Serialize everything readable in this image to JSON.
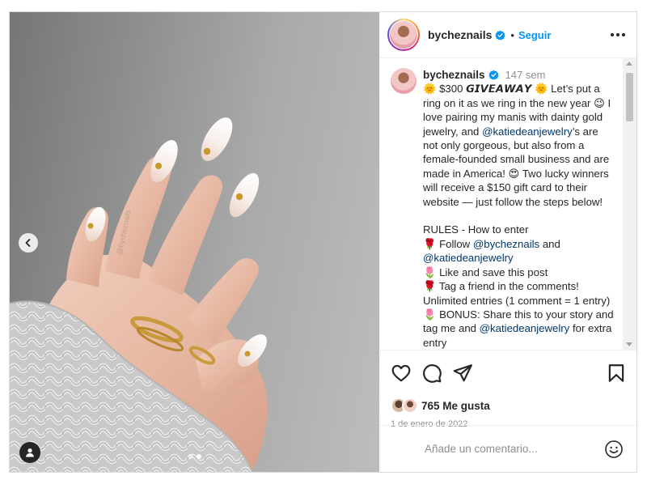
{
  "post": {
    "username": "bycheznails",
    "follow_label": "Seguir",
    "caption": {
      "username": "bycheznails",
      "time_ago": "147 sem",
      "segments": [
        {
          "t": "🌞 $300 "
        },
        {
          "t": "𝙂𝙄𝙑𝙀𝘼𝙒𝘼𝙔"
        },
        {
          "t": " 🌞 Let’s put a ring on it as we ring in the new year 😉 I love pairing my manis with dainty gold jewelry, and "
        },
        {
          "t": "@katiedeanjewelry",
          "mention": true
        },
        {
          "t": "’s are not only gorgeous, but also from a female-founded small business and are made in America! 😍 Two lucky winners will receive a $150 gift card to their website — just follow the steps below!\n\nRULES - How to enter\n🌹 Follow "
        },
        {
          "t": "@bycheznails",
          "mention": true
        },
        {
          "t": " and "
        },
        {
          "t": "@katiedeanjewelry",
          "mention": true
        },
        {
          "t": "\n🌷 Like and save this post\n🌹 Tag a friend in the comments! Unlimited entries (1 comment = 1 entry)\n🌷 BONUS: Share this to your story and tag me and "
        },
        {
          "t": "@katiedeanjewelry",
          "mention": true
        },
        {
          "t": " for extra entry"
        }
      ]
    },
    "likes": "765 Me gusta",
    "date": "1 de enero de 2022",
    "comment_placeholder": "Añade un comentario...",
    "carousel": {
      "total": 2,
      "active_index": 1
    },
    "watermark": "@bycheznails"
  },
  "icons": {
    "verified": "verified-badge-icon",
    "more": "more-options-icon",
    "like": "heart-icon",
    "comment": "comment-icon",
    "share": "paper-plane-icon",
    "save": "bookmark-icon",
    "emoji": "smiley-icon",
    "tag": "user-tag-icon",
    "prev": "chevron-left-icon"
  },
  "colors": {
    "follow": "#0095f6",
    "mention": "#00376b",
    "verified": "#0095f6",
    "muted": "#8e8e8e"
  }
}
